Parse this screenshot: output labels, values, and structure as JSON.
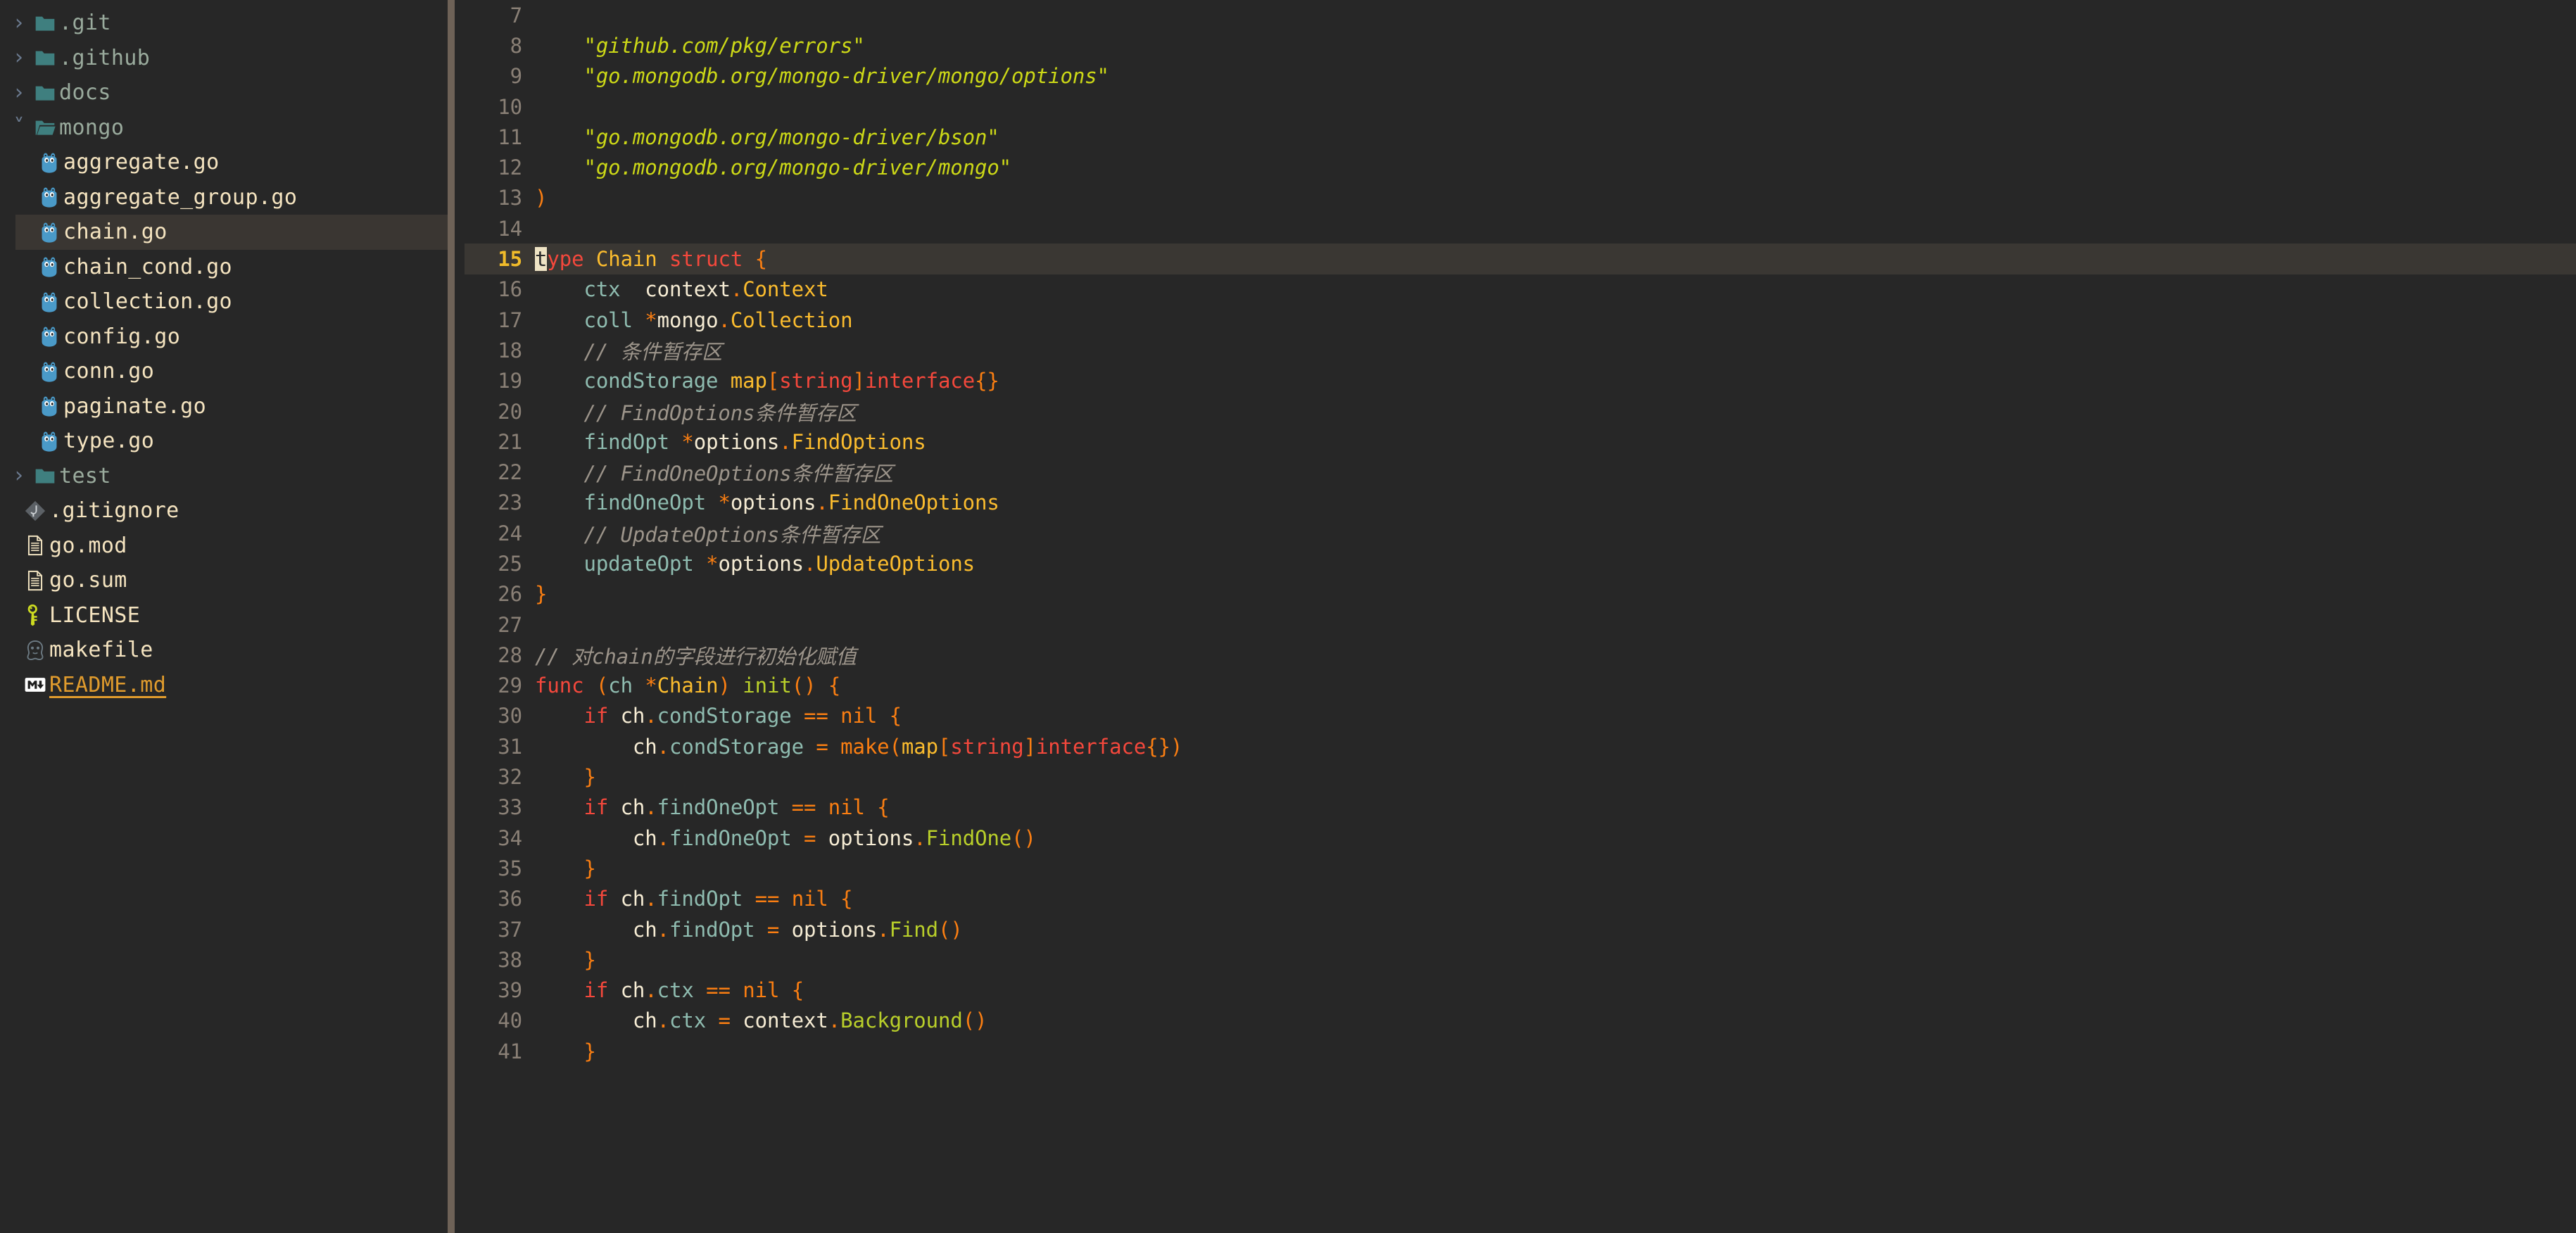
{
  "theme": {
    "bg": "#272727",
    "sidebar_bg": "#272727",
    "selected_row_bg": "#3a3632",
    "current_line_bg": "#3a3733",
    "scrollbar": "#6e6257",
    "accent_line_number": "#f0bb2a",
    "folder_color": "#9aab9d",
    "file_color": "#f5e4c0",
    "markdown_color": "#e09b2d",
    "string_color": "#ccd817",
    "comment_color": "#9c948a",
    "keyword_color": "#f4483c",
    "type_color": "#fbbc2e",
    "field_color": "#8fbcb0",
    "punct_color": "#fa7e12",
    "func_color": "#b9cf2a",
    "cursor_bg": "#eee3c4"
  },
  "sidebar": {
    "items": [
      {
        "label": ".git",
        "kind": "folder",
        "icon": "folder-closed-icon",
        "expanded": false,
        "depth": 0,
        "selected": false
      },
      {
        "label": ".github",
        "kind": "folder",
        "icon": "folder-closed-icon",
        "expanded": false,
        "depth": 0,
        "selected": false
      },
      {
        "label": "docs",
        "kind": "folder",
        "icon": "folder-closed-icon",
        "expanded": false,
        "depth": 0,
        "selected": false
      },
      {
        "label": "mongo",
        "kind": "folder",
        "icon": "folder-open-icon",
        "expanded": true,
        "depth": 0,
        "selected": false
      },
      {
        "label": "aggregate.go",
        "kind": "file",
        "icon": "go-gopher-icon",
        "depth": 1,
        "selected": false
      },
      {
        "label": "aggregate_group.go",
        "kind": "file",
        "icon": "go-gopher-icon",
        "depth": 1,
        "selected": false
      },
      {
        "label": "chain.go",
        "kind": "file",
        "icon": "go-gopher-icon",
        "depth": 1,
        "selected": true
      },
      {
        "label": "chain_cond.go",
        "kind": "file",
        "icon": "go-gopher-icon",
        "depth": 1,
        "selected": false
      },
      {
        "label": "collection.go",
        "kind": "file",
        "icon": "go-gopher-icon",
        "depth": 1,
        "selected": false
      },
      {
        "label": "config.go",
        "kind": "file",
        "icon": "go-gopher-icon",
        "depth": 1,
        "selected": false
      },
      {
        "label": "conn.go",
        "kind": "file",
        "icon": "go-gopher-icon",
        "depth": 1,
        "selected": false
      },
      {
        "label": "paginate.go",
        "kind": "file",
        "icon": "go-gopher-icon",
        "depth": 1,
        "selected": false
      },
      {
        "label": "type.go",
        "kind": "file",
        "icon": "go-gopher-icon",
        "depth": 1,
        "selected": false
      },
      {
        "label": "test",
        "kind": "folder",
        "icon": "folder-closed-icon",
        "expanded": false,
        "depth": 0,
        "selected": false
      },
      {
        "label": ".gitignore",
        "kind": "file",
        "icon": "git-icon",
        "depth": 0.5,
        "selected": false
      },
      {
        "label": "go.mod",
        "kind": "file",
        "icon": "document-icon",
        "depth": 0.5,
        "selected": false
      },
      {
        "label": "go.sum",
        "kind": "file",
        "icon": "document-icon",
        "depth": 0.5,
        "selected": false
      },
      {
        "label": "LICENSE",
        "kind": "file",
        "icon": "key-icon",
        "depth": 0.5,
        "selected": false
      },
      {
        "label": "makefile",
        "kind": "file",
        "icon": "gnu-icon",
        "depth": 0.5,
        "selected": false
      },
      {
        "label": "README.md",
        "kind": "markdown",
        "icon": "markdown-icon",
        "depth": 0.5,
        "selected": false
      }
    ]
  },
  "editor": {
    "active_file": "chain.go",
    "language": "go",
    "cursor": {
      "line": 15,
      "column": 1,
      "char": "t"
    },
    "first_visible_line": 7,
    "lines": [
      {
        "n": 7,
        "tokens": []
      },
      {
        "n": 8,
        "tokens": [
          {
            "t": "\t",
            "c": "plain"
          },
          {
            "t": "\"github.com/pkg/errors\"",
            "c": "str"
          }
        ]
      },
      {
        "n": 9,
        "tokens": [
          {
            "t": "\t",
            "c": "plain"
          },
          {
            "t": "\"go.mongodb.org/mongo-driver/mongo/options\"",
            "c": "str"
          }
        ]
      },
      {
        "n": 10,
        "tokens": []
      },
      {
        "n": 11,
        "tokens": [
          {
            "t": "\t",
            "c": "plain"
          },
          {
            "t": "\"go.mongodb.org/mongo-driver/bson\"",
            "c": "str"
          }
        ]
      },
      {
        "n": 12,
        "tokens": [
          {
            "t": "\t",
            "c": "plain"
          },
          {
            "t": "\"go.mongodb.org/mongo-driver/mongo\"",
            "c": "str"
          }
        ]
      },
      {
        "n": 13,
        "tokens": [
          {
            "t": ")",
            "c": "pun"
          }
        ]
      },
      {
        "n": 14,
        "tokens": []
      },
      {
        "n": 15,
        "current": true,
        "tokens": [
          {
            "t": "t",
            "c": "cursor"
          },
          {
            "t": "ype",
            "c": "kw"
          },
          {
            "t": " ",
            "c": "plain"
          },
          {
            "t": "Chain",
            "c": "typ"
          },
          {
            "t": " ",
            "c": "plain"
          },
          {
            "t": "struct",
            "c": "kw"
          },
          {
            "t": " ",
            "c": "plain"
          },
          {
            "t": "{",
            "c": "pun"
          }
        ]
      },
      {
        "n": 16,
        "tokens": [
          {
            "t": "\t",
            "c": "plain"
          },
          {
            "t": "ctx",
            "c": "fld"
          },
          {
            "t": "  ",
            "c": "plain"
          },
          {
            "t": "context",
            "c": "plain"
          },
          {
            "t": ".",
            "c": "pun"
          },
          {
            "t": "Context",
            "c": "typ"
          }
        ]
      },
      {
        "n": 17,
        "tokens": [
          {
            "t": "\t",
            "c": "plain"
          },
          {
            "t": "coll",
            "c": "fld"
          },
          {
            "t": " ",
            "c": "plain"
          },
          {
            "t": "*",
            "c": "pun"
          },
          {
            "t": "mongo",
            "c": "plain"
          },
          {
            "t": ".",
            "c": "pun"
          },
          {
            "t": "Collection",
            "c": "typ"
          }
        ]
      },
      {
        "n": 18,
        "tokens": [
          {
            "t": "\t",
            "c": "plain"
          },
          {
            "t": "// 条件暂存区",
            "c": "cmt"
          }
        ]
      },
      {
        "n": 19,
        "tokens": [
          {
            "t": "\t",
            "c": "plain"
          },
          {
            "t": "condStorage",
            "c": "fld"
          },
          {
            "t": " ",
            "c": "plain"
          },
          {
            "t": "map",
            "c": "typ"
          },
          {
            "t": "[",
            "c": "pun"
          },
          {
            "t": "string",
            "c": "kw"
          },
          {
            "t": "]",
            "c": "pun"
          },
          {
            "t": "interface",
            "c": "kw"
          },
          {
            "t": "{}",
            "c": "pun"
          }
        ]
      },
      {
        "n": 20,
        "tokens": [
          {
            "t": "\t",
            "c": "plain"
          },
          {
            "t": "// FindOptions条件暂存区",
            "c": "cmt"
          }
        ]
      },
      {
        "n": 21,
        "tokens": [
          {
            "t": "\t",
            "c": "plain"
          },
          {
            "t": "findOpt",
            "c": "fld"
          },
          {
            "t": " ",
            "c": "plain"
          },
          {
            "t": "*",
            "c": "pun"
          },
          {
            "t": "options",
            "c": "plain"
          },
          {
            "t": ".",
            "c": "pun"
          },
          {
            "t": "FindOptions",
            "c": "typ"
          }
        ]
      },
      {
        "n": 22,
        "tokens": [
          {
            "t": "\t",
            "c": "plain"
          },
          {
            "t": "// FindOneOptions条件暂存区",
            "c": "cmt"
          }
        ]
      },
      {
        "n": 23,
        "tokens": [
          {
            "t": "\t",
            "c": "plain"
          },
          {
            "t": "findOneOpt",
            "c": "fld"
          },
          {
            "t": " ",
            "c": "plain"
          },
          {
            "t": "*",
            "c": "pun"
          },
          {
            "t": "options",
            "c": "plain"
          },
          {
            "t": ".",
            "c": "pun"
          },
          {
            "t": "FindOneOptions",
            "c": "typ"
          }
        ]
      },
      {
        "n": 24,
        "tokens": [
          {
            "t": "\t",
            "c": "plain"
          },
          {
            "t": "// UpdateOptions条件暂存区",
            "c": "cmt"
          }
        ]
      },
      {
        "n": 25,
        "tokens": [
          {
            "t": "\t",
            "c": "plain"
          },
          {
            "t": "updateOpt",
            "c": "fld"
          },
          {
            "t": " ",
            "c": "plain"
          },
          {
            "t": "*",
            "c": "pun"
          },
          {
            "t": "options",
            "c": "plain"
          },
          {
            "t": ".",
            "c": "pun"
          },
          {
            "t": "UpdateOptions",
            "c": "typ"
          }
        ]
      },
      {
        "n": 26,
        "tokens": [
          {
            "t": "}",
            "c": "pun"
          }
        ]
      },
      {
        "n": 27,
        "tokens": []
      },
      {
        "n": 28,
        "tokens": [
          {
            "t": "// 对chain的字段进行初始化赋值",
            "c": "cmt"
          }
        ]
      },
      {
        "n": 29,
        "tokens": [
          {
            "t": "func",
            "c": "kw"
          },
          {
            "t": " ",
            "c": "plain"
          },
          {
            "t": "(",
            "c": "pun"
          },
          {
            "t": "ch",
            "c": "fld"
          },
          {
            "t": " ",
            "c": "plain"
          },
          {
            "t": "*",
            "c": "pun"
          },
          {
            "t": "Chain",
            "c": "typ"
          },
          {
            "t": ")",
            "c": "pun"
          },
          {
            "t": " ",
            "c": "plain"
          },
          {
            "t": "init",
            "c": "fn"
          },
          {
            "t": "()",
            "c": "pun"
          },
          {
            "t": " ",
            "c": "plain"
          },
          {
            "t": "{",
            "c": "pun"
          }
        ]
      },
      {
        "n": 30,
        "tokens": [
          {
            "t": "\t",
            "c": "plain"
          },
          {
            "t": "if",
            "c": "kw"
          },
          {
            "t": " ",
            "c": "plain"
          },
          {
            "t": "ch",
            "c": "plain"
          },
          {
            "t": ".",
            "c": "pun"
          },
          {
            "t": "condStorage",
            "c": "fld"
          },
          {
            "t": " ",
            "c": "plain"
          },
          {
            "t": "==",
            "c": "pun"
          },
          {
            "t": " ",
            "c": "plain"
          },
          {
            "t": "nil",
            "c": "pun"
          },
          {
            "t": " ",
            "c": "plain"
          },
          {
            "t": "{",
            "c": "pun"
          }
        ]
      },
      {
        "n": 31,
        "tokens": [
          {
            "t": "\t\t",
            "c": "plain"
          },
          {
            "t": "ch",
            "c": "plain"
          },
          {
            "t": ".",
            "c": "pun"
          },
          {
            "t": "condStorage",
            "c": "fld"
          },
          {
            "t": " ",
            "c": "plain"
          },
          {
            "t": "=",
            "c": "pun"
          },
          {
            "t": " ",
            "c": "plain"
          },
          {
            "t": "make",
            "c": "pun"
          },
          {
            "t": "(",
            "c": "pun"
          },
          {
            "t": "map",
            "c": "typ"
          },
          {
            "t": "[",
            "c": "pun"
          },
          {
            "t": "string",
            "c": "kw"
          },
          {
            "t": "]",
            "c": "pun"
          },
          {
            "t": "interface",
            "c": "kw"
          },
          {
            "t": "{})",
            "c": "pun"
          }
        ]
      },
      {
        "n": 32,
        "tokens": [
          {
            "t": "\t",
            "c": "plain"
          },
          {
            "t": "}",
            "c": "pun"
          }
        ]
      },
      {
        "n": 33,
        "tokens": [
          {
            "t": "\t",
            "c": "plain"
          },
          {
            "t": "if",
            "c": "kw"
          },
          {
            "t": " ",
            "c": "plain"
          },
          {
            "t": "ch",
            "c": "plain"
          },
          {
            "t": ".",
            "c": "pun"
          },
          {
            "t": "findOneOpt",
            "c": "fld"
          },
          {
            "t": " ",
            "c": "plain"
          },
          {
            "t": "==",
            "c": "pun"
          },
          {
            "t": " ",
            "c": "plain"
          },
          {
            "t": "nil",
            "c": "pun"
          },
          {
            "t": " ",
            "c": "plain"
          },
          {
            "t": "{",
            "c": "pun"
          }
        ]
      },
      {
        "n": 34,
        "tokens": [
          {
            "t": "\t\t",
            "c": "plain"
          },
          {
            "t": "ch",
            "c": "plain"
          },
          {
            "t": ".",
            "c": "pun"
          },
          {
            "t": "findOneOpt",
            "c": "fld"
          },
          {
            "t": " ",
            "c": "plain"
          },
          {
            "t": "=",
            "c": "pun"
          },
          {
            "t": " ",
            "c": "plain"
          },
          {
            "t": "options",
            "c": "plain"
          },
          {
            "t": ".",
            "c": "pun"
          },
          {
            "t": "FindOne",
            "c": "fn"
          },
          {
            "t": "()",
            "c": "pun"
          }
        ]
      },
      {
        "n": 35,
        "tokens": [
          {
            "t": "\t",
            "c": "plain"
          },
          {
            "t": "}",
            "c": "pun"
          }
        ]
      },
      {
        "n": 36,
        "tokens": [
          {
            "t": "\t",
            "c": "plain"
          },
          {
            "t": "if",
            "c": "kw"
          },
          {
            "t": " ",
            "c": "plain"
          },
          {
            "t": "ch",
            "c": "plain"
          },
          {
            "t": ".",
            "c": "pun"
          },
          {
            "t": "findOpt",
            "c": "fld"
          },
          {
            "t": " ",
            "c": "plain"
          },
          {
            "t": "==",
            "c": "pun"
          },
          {
            "t": " ",
            "c": "plain"
          },
          {
            "t": "nil",
            "c": "pun"
          },
          {
            "t": " ",
            "c": "plain"
          },
          {
            "t": "{",
            "c": "pun"
          }
        ]
      },
      {
        "n": 37,
        "tokens": [
          {
            "t": "\t\t",
            "c": "plain"
          },
          {
            "t": "ch",
            "c": "plain"
          },
          {
            "t": ".",
            "c": "pun"
          },
          {
            "t": "findOpt",
            "c": "fld"
          },
          {
            "t": " ",
            "c": "plain"
          },
          {
            "t": "=",
            "c": "pun"
          },
          {
            "t": " ",
            "c": "plain"
          },
          {
            "t": "options",
            "c": "plain"
          },
          {
            "t": ".",
            "c": "pun"
          },
          {
            "t": "Find",
            "c": "fn"
          },
          {
            "t": "()",
            "c": "pun"
          }
        ]
      },
      {
        "n": 38,
        "tokens": [
          {
            "t": "\t",
            "c": "plain"
          },
          {
            "t": "}",
            "c": "pun"
          }
        ]
      },
      {
        "n": 39,
        "tokens": [
          {
            "t": "\t",
            "c": "plain"
          },
          {
            "t": "if",
            "c": "kw"
          },
          {
            "t": " ",
            "c": "plain"
          },
          {
            "t": "ch",
            "c": "plain"
          },
          {
            "t": ".",
            "c": "pun"
          },
          {
            "t": "ctx",
            "c": "fld"
          },
          {
            "t": " ",
            "c": "plain"
          },
          {
            "t": "==",
            "c": "pun"
          },
          {
            "t": " ",
            "c": "plain"
          },
          {
            "t": "nil",
            "c": "pun"
          },
          {
            "t": " ",
            "c": "plain"
          },
          {
            "t": "{",
            "c": "pun"
          }
        ]
      },
      {
        "n": 40,
        "tokens": [
          {
            "t": "\t\t",
            "c": "plain"
          },
          {
            "t": "ch",
            "c": "plain"
          },
          {
            "t": ".",
            "c": "pun"
          },
          {
            "t": "ctx",
            "c": "fld"
          },
          {
            "t": " ",
            "c": "plain"
          },
          {
            "t": "=",
            "c": "pun"
          },
          {
            "t": " ",
            "c": "plain"
          },
          {
            "t": "context",
            "c": "plain"
          },
          {
            "t": ".",
            "c": "pun"
          },
          {
            "t": "Background",
            "c": "fn"
          },
          {
            "t": "()",
            "c": "pun"
          }
        ]
      },
      {
        "n": 41,
        "tokens": [
          {
            "t": "\t",
            "c": "plain"
          },
          {
            "t": "}",
            "c": "pun"
          }
        ]
      }
    ]
  }
}
